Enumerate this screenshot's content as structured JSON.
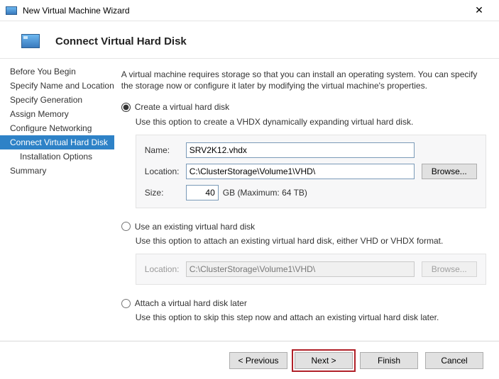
{
  "window": {
    "title": "New Virtual Machine Wizard",
    "close_glyph": "✕"
  },
  "header": {
    "title": "Connect Virtual Hard Disk"
  },
  "sidebar": {
    "items": [
      "Before You Begin",
      "Specify Name and Location",
      "Specify Generation",
      "Assign Memory",
      "Configure Networking",
      "Connect Virtual Hard Disk",
      "Installation Options",
      "Summary"
    ]
  },
  "main": {
    "intro": "A virtual machine requires storage so that you can install an operating system. You can specify the storage now or configure it later by modifying the virtual machine's properties.",
    "opt1": {
      "label": "Create a virtual hard disk",
      "desc": "Use this option to create a VHDX dynamically expanding virtual hard disk.",
      "name_lbl": "Name:",
      "name_val": "SRV2K12.vhdx",
      "loc_lbl": "Location:",
      "loc_val": "C:\\ClusterStorage\\Volume1\\VHD\\",
      "browse": "Browse...",
      "size_lbl": "Size:",
      "size_val": "40",
      "size_suffix": "GB (Maximum: 64 TB)"
    },
    "opt2": {
      "label": "Use an existing virtual hard disk",
      "desc": "Use this option to attach an existing virtual hard disk, either VHD or VHDX format.",
      "loc_lbl": "Location:",
      "loc_val": "C:\\ClusterStorage\\Volume1\\VHD\\",
      "browse": "Browse..."
    },
    "opt3": {
      "label": "Attach a virtual hard disk later",
      "desc": "Use this option to skip this step now and attach an existing virtual hard disk later."
    }
  },
  "footer": {
    "previous": "< Previous",
    "next": "Next >",
    "finish": "Finish",
    "cancel": "Cancel"
  }
}
